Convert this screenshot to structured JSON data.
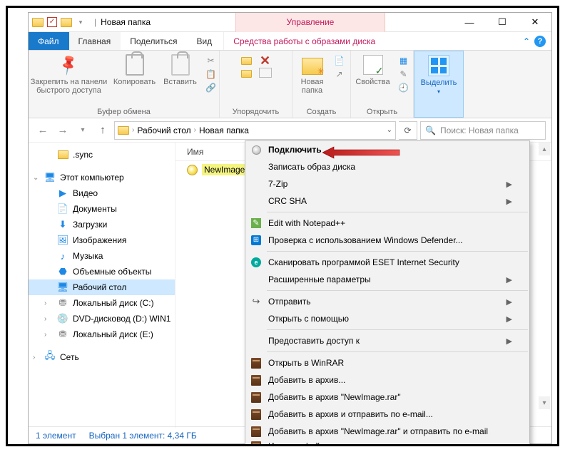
{
  "title": {
    "text": "Новая папка",
    "toolContext": "Управление"
  },
  "tabs": {
    "file": "Файл",
    "home": "Главная",
    "share": "Поделиться",
    "view": "Вид",
    "discTools": "Средства работы с образами диска"
  },
  "ribbon": {
    "pin": "Закрепить на панели\nбыстрого доступа",
    "copy": "Копировать",
    "paste": "Вставить",
    "clipboardGroup": "Буфер обмена",
    "organizeGroup": "Упорядочить",
    "newFolder": "Новая\nпапка",
    "createGroup": "Создать",
    "properties": "Свойства",
    "openGroup": "Открыть",
    "select": "Выделить",
    "selectGroup": ""
  },
  "breadcrumb": {
    "a": "Рабочий стол",
    "b": "Новая папка"
  },
  "search": {
    "placeholder": "Поиск: Новая папка"
  },
  "columns": {
    "name": "Имя"
  },
  "file": {
    "name": "NewImage"
  },
  "tree": {
    "sync": ".sync",
    "thisPc": "Этот компьютер",
    "video": "Видео",
    "documents": "Документы",
    "downloads": "Загрузки",
    "pictures": "Изображения",
    "music": "Музыка",
    "objects3d": "Объемные объекты",
    "desktop": "Рабочий стол",
    "diskC": "Локальный диск (C:)",
    "dvd": "DVD-дисковод (D:) WIN1",
    "diskE": "Локальный диск (E:)",
    "network": "Сеть"
  },
  "ctx": {
    "mount": "Подключить",
    "burn": "Записать образ диска",
    "sevenZip": "7-Zip",
    "crc": "CRC SHA",
    "npp": "Edit with Notepad++",
    "defender": "Проверка с использованием Windows Defender...",
    "eset": "Сканировать программой ESET Internet Security",
    "esetAdv": "Расширенные параметры",
    "sendTo": "Отправить",
    "openWith": "Открыть с помощью",
    "giveAccess": "Предоставить доступ к",
    "openRar": "Открыть в WinRAR",
    "addArchive": "Добавить в архив...",
    "addRar": "Добавить в архив \"NewImage.rar\"",
    "addEmail": "Добавить в архив и отправить по e-mail...",
    "addRarEmail": "Добавить в архив \"NewImage.rar\" и отправить по e-mail",
    "extract": "Извлечь файлы"
  },
  "status": {
    "count": "1 элемент",
    "selected": "Выбран 1 элемент: 4,34 ГБ"
  }
}
